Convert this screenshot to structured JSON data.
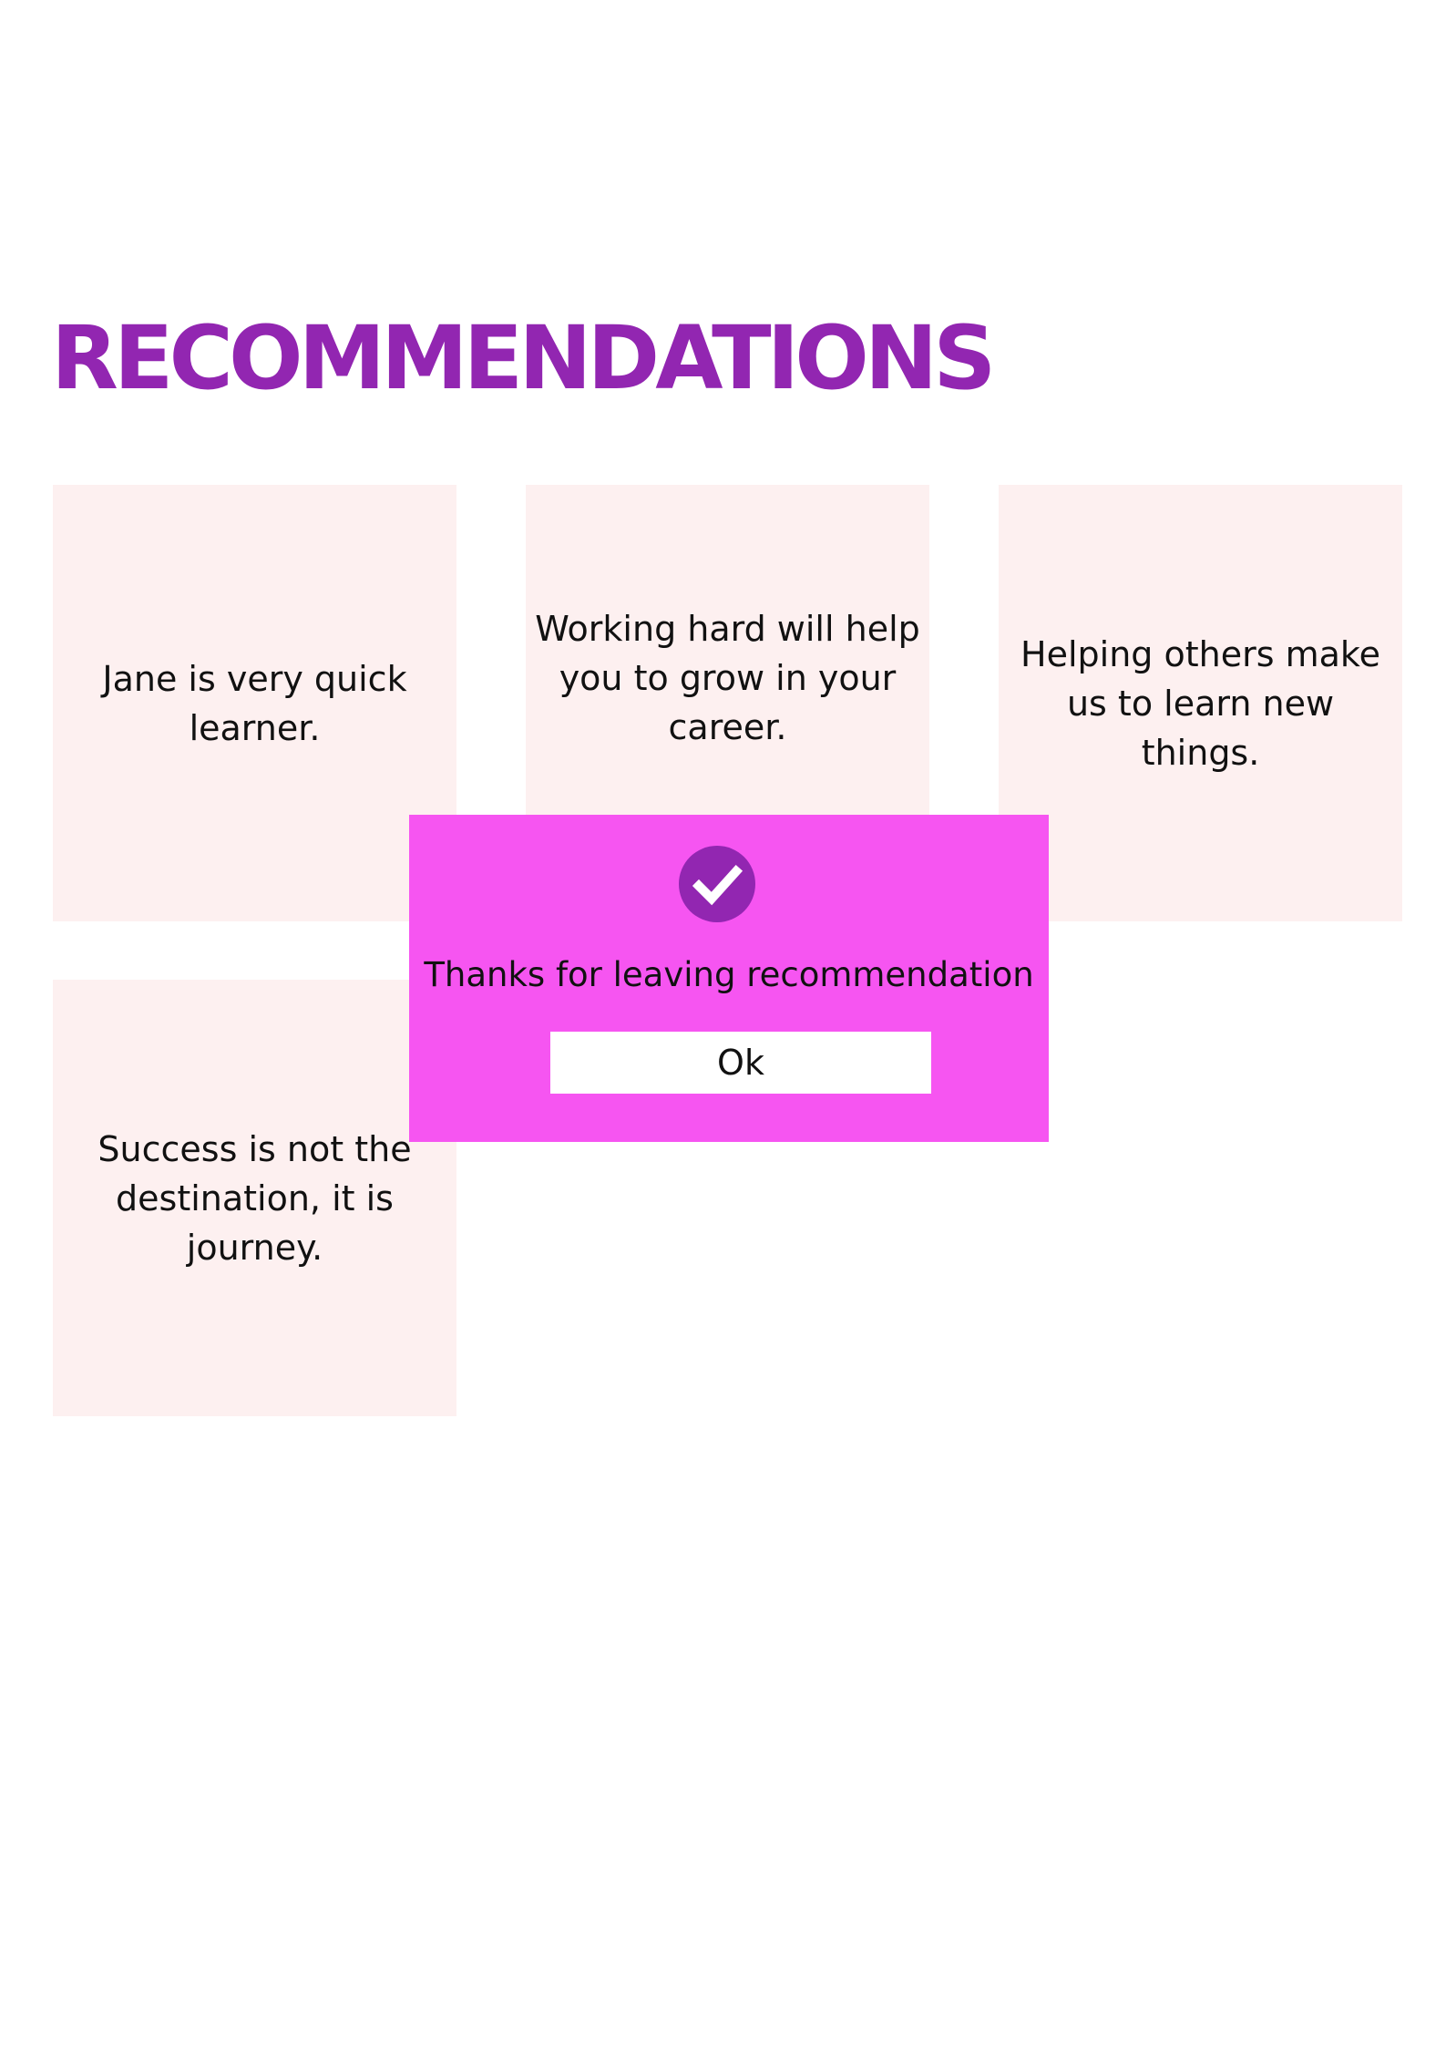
{
  "page": {
    "title": "RECOMMENDATIONS"
  },
  "recommendations": [
    {
      "text": "Jane is very quick learner."
    },
    {
      "text": "Working hard will help you to grow in your career."
    },
    {
      "text": "Helping others make us to learn new things."
    },
    {
      "text": "Success is not the destination, it is journey."
    }
  ],
  "dialog": {
    "icon": "check-circle-icon",
    "message": "Thanks for leaving recommendation",
    "ok_label": "Ok"
  },
  "colors": {
    "title": "#9226b1",
    "card_background": "#fdf0f0",
    "dialog_background": "#f655f1",
    "icon_background": "#9226b1",
    "button_background": "#ffffff"
  }
}
